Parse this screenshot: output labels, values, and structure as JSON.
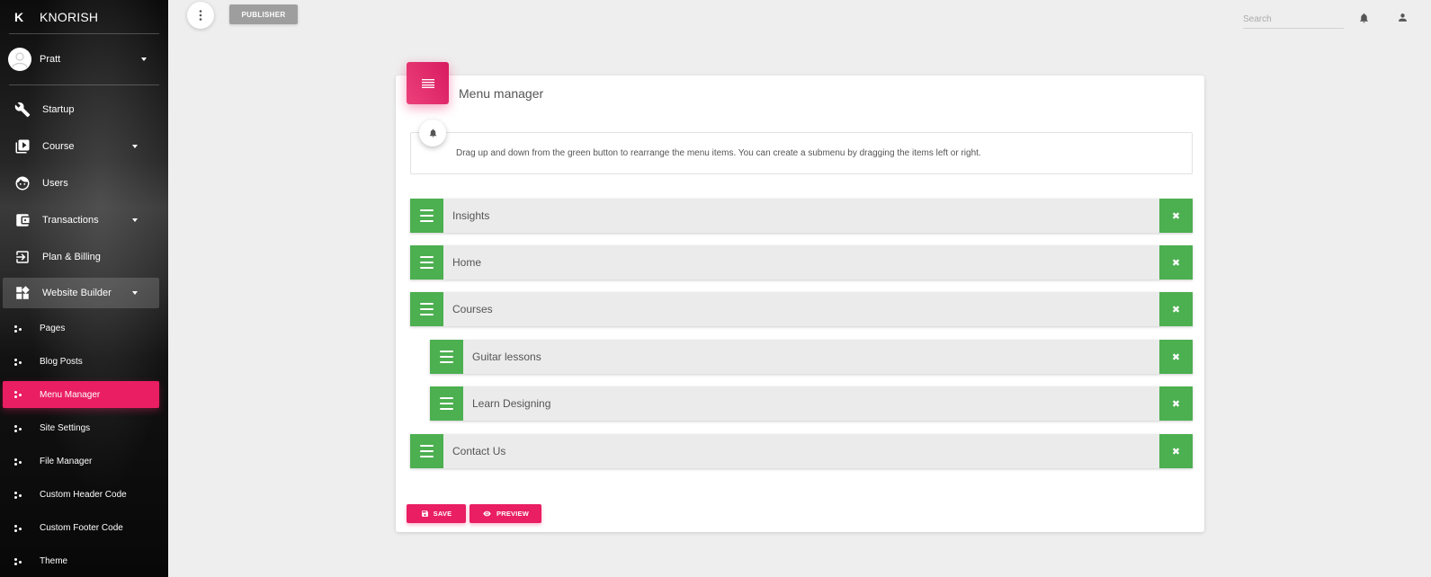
{
  "sidebar": {
    "logo_mini": "K",
    "logo_full": "KNORISH",
    "user_name": "Pratt",
    "items": [
      {
        "label": "Startup",
        "icon": "wrench-icon"
      },
      {
        "label": "Course",
        "icon": "video-library-icon",
        "has_caret": true
      },
      {
        "label": "Users",
        "icon": "face-icon"
      },
      {
        "label": "Transactions",
        "icon": "wallet-icon",
        "has_caret": true
      },
      {
        "label": "Plan & Billing",
        "icon": "exit-to-app-icon"
      },
      {
        "label": "Website Builder",
        "icon": "widgets-icon",
        "has_caret": true,
        "expanded": true
      }
    ],
    "sub_items": [
      {
        "label": "Pages"
      },
      {
        "label": "Blog Posts"
      },
      {
        "label": "Menu Manager",
        "active": true
      },
      {
        "label": "Site Settings"
      },
      {
        "label": "File Manager"
      },
      {
        "label": "Custom Header Code"
      },
      {
        "label": "Custom Footer Code"
      },
      {
        "label": "Theme"
      }
    ]
  },
  "topbar": {
    "publisher_label": "PUBLISHER",
    "search_placeholder": "Search"
  },
  "card": {
    "title": "Menu manager",
    "instructions": "Drag up and down from the green button to rearrange the menu items. You can create a submenu by dragging the items left or right.",
    "menu_items": [
      {
        "label": "Insights",
        "level": 0
      },
      {
        "label": "Home",
        "level": 0
      },
      {
        "label": "Courses",
        "level": 0
      },
      {
        "label": "Guitar lessons",
        "level": 1
      },
      {
        "label": "Learn Designing",
        "level": 1
      },
      {
        "label": "Contact Us",
        "level": 0
      }
    ],
    "save_label": "SAVE",
    "preview_label": "PREVIEW"
  },
  "colors": {
    "accent": "#e91e63",
    "handle_green": "#4caf50",
    "publisher_gray": "#9e9e9e"
  }
}
